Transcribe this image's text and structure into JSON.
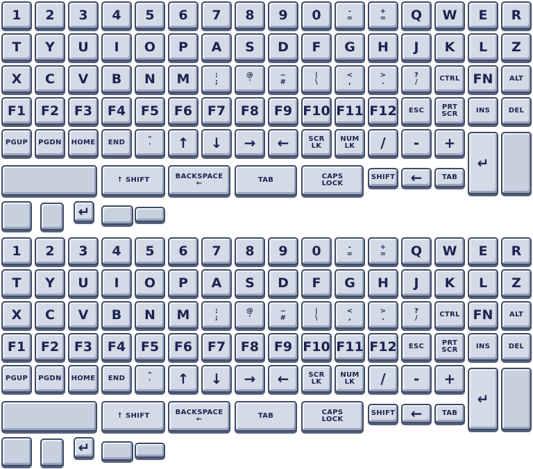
{
  "rows": [
    [
      "1",
      "2",
      "3",
      "4",
      "5",
      "6",
      "7",
      "8",
      "9",
      "0",
      "-\n=",
      "+\n=",
      "Q",
      "W",
      "E",
      "R"
    ],
    [
      "T",
      "Y",
      "U",
      "I",
      "O",
      "P",
      "A",
      "S",
      "D",
      "F",
      "G",
      "H",
      "J",
      "K",
      "L",
      "Z"
    ],
    [
      "X",
      "C",
      "V",
      "B",
      "N",
      "M",
      ":\n;",
      "@\n'",
      "~\n#",
      "|\n\\",
      "<\n,",
      ">\n.",
      "?\n/",
      "CTRL",
      "FN",
      "ALT"
    ],
    [
      "F1",
      "F2",
      "F3",
      "F4",
      "F5",
      "F6",
      "F7",
      "F8",
      "F9",
      "F10",
      "F11",
      "F12",
      "ESC",
      "PRT\nSCR",
      "INS",
      "DEL"
    ],
    [
      "PGUP",
      "PGDN",
      "HOME",
      "END",
      "\"\n'",
      "↑",
      "↓",
      "→",
      "←",
      "SCR\nLK",
      "NUM\nLK",
      "/",
      "-",
      "+"
    ]
  ],
  "row6": {
    "shift_label": "↑ SHIFT",
    "backspace_label": "BACKSPACE\n←",
    "tab_label": "TAB",
    "caps_label": "CAPS\nLOCK",
    "small_shift_label": "SHIFT",
    "small_arrow_label": "←",
    "small_tab_label": "TAB"
  },
  "enter_label": "↵",
  "row7_enter_label": "↵"
}
